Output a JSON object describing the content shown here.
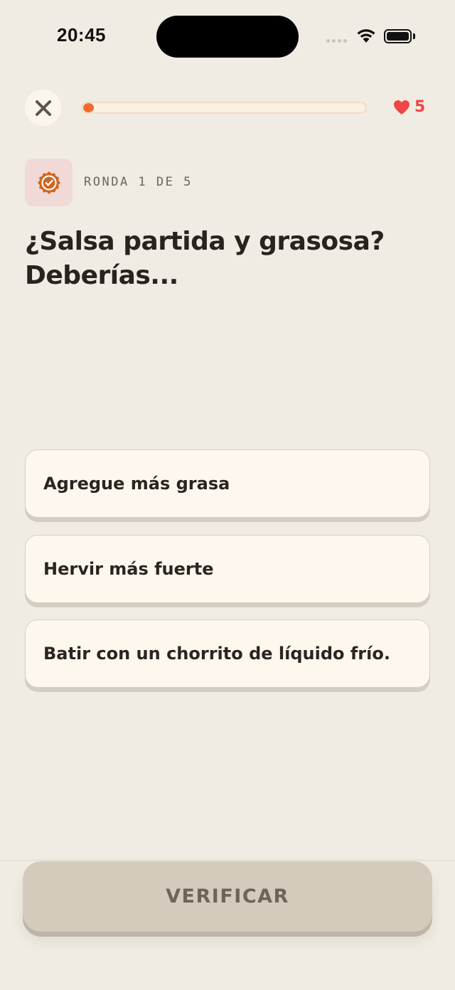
{
  "status_bar": {
    "time": "20:45"
  },
  "top_bar": {
    "close_icon": "close-x-icon",
    "progress": 0.0,
    "hearts_icon": "heart-icon",
    "hearts_count": "5"
  },
  "round": {
    "icon": "verified-badge-icon",
    "label": "RONDA 1 DE 5"
  },
  "question": {
    "text": "¿Salsa partida y grasosa? Deberías..."
  },
  "options": [
    {
      "label": "Agregue más grasa"
    },
    {
      "label": "Hervir más fuerte"
    },
    {
      "label": "Batir con un chorrito de líquido frío."
    }
  ],
  "footer": {
    "verify_label": "VERIFICAR"
  },
  "colors": {
    "background": "#f1ece3",
    "accent": "#f46a2a",
    "heart": "#ee4646",
    "card": "#fdf7ee",
    "button_disabled": "#d4cbbd"
  }
}
